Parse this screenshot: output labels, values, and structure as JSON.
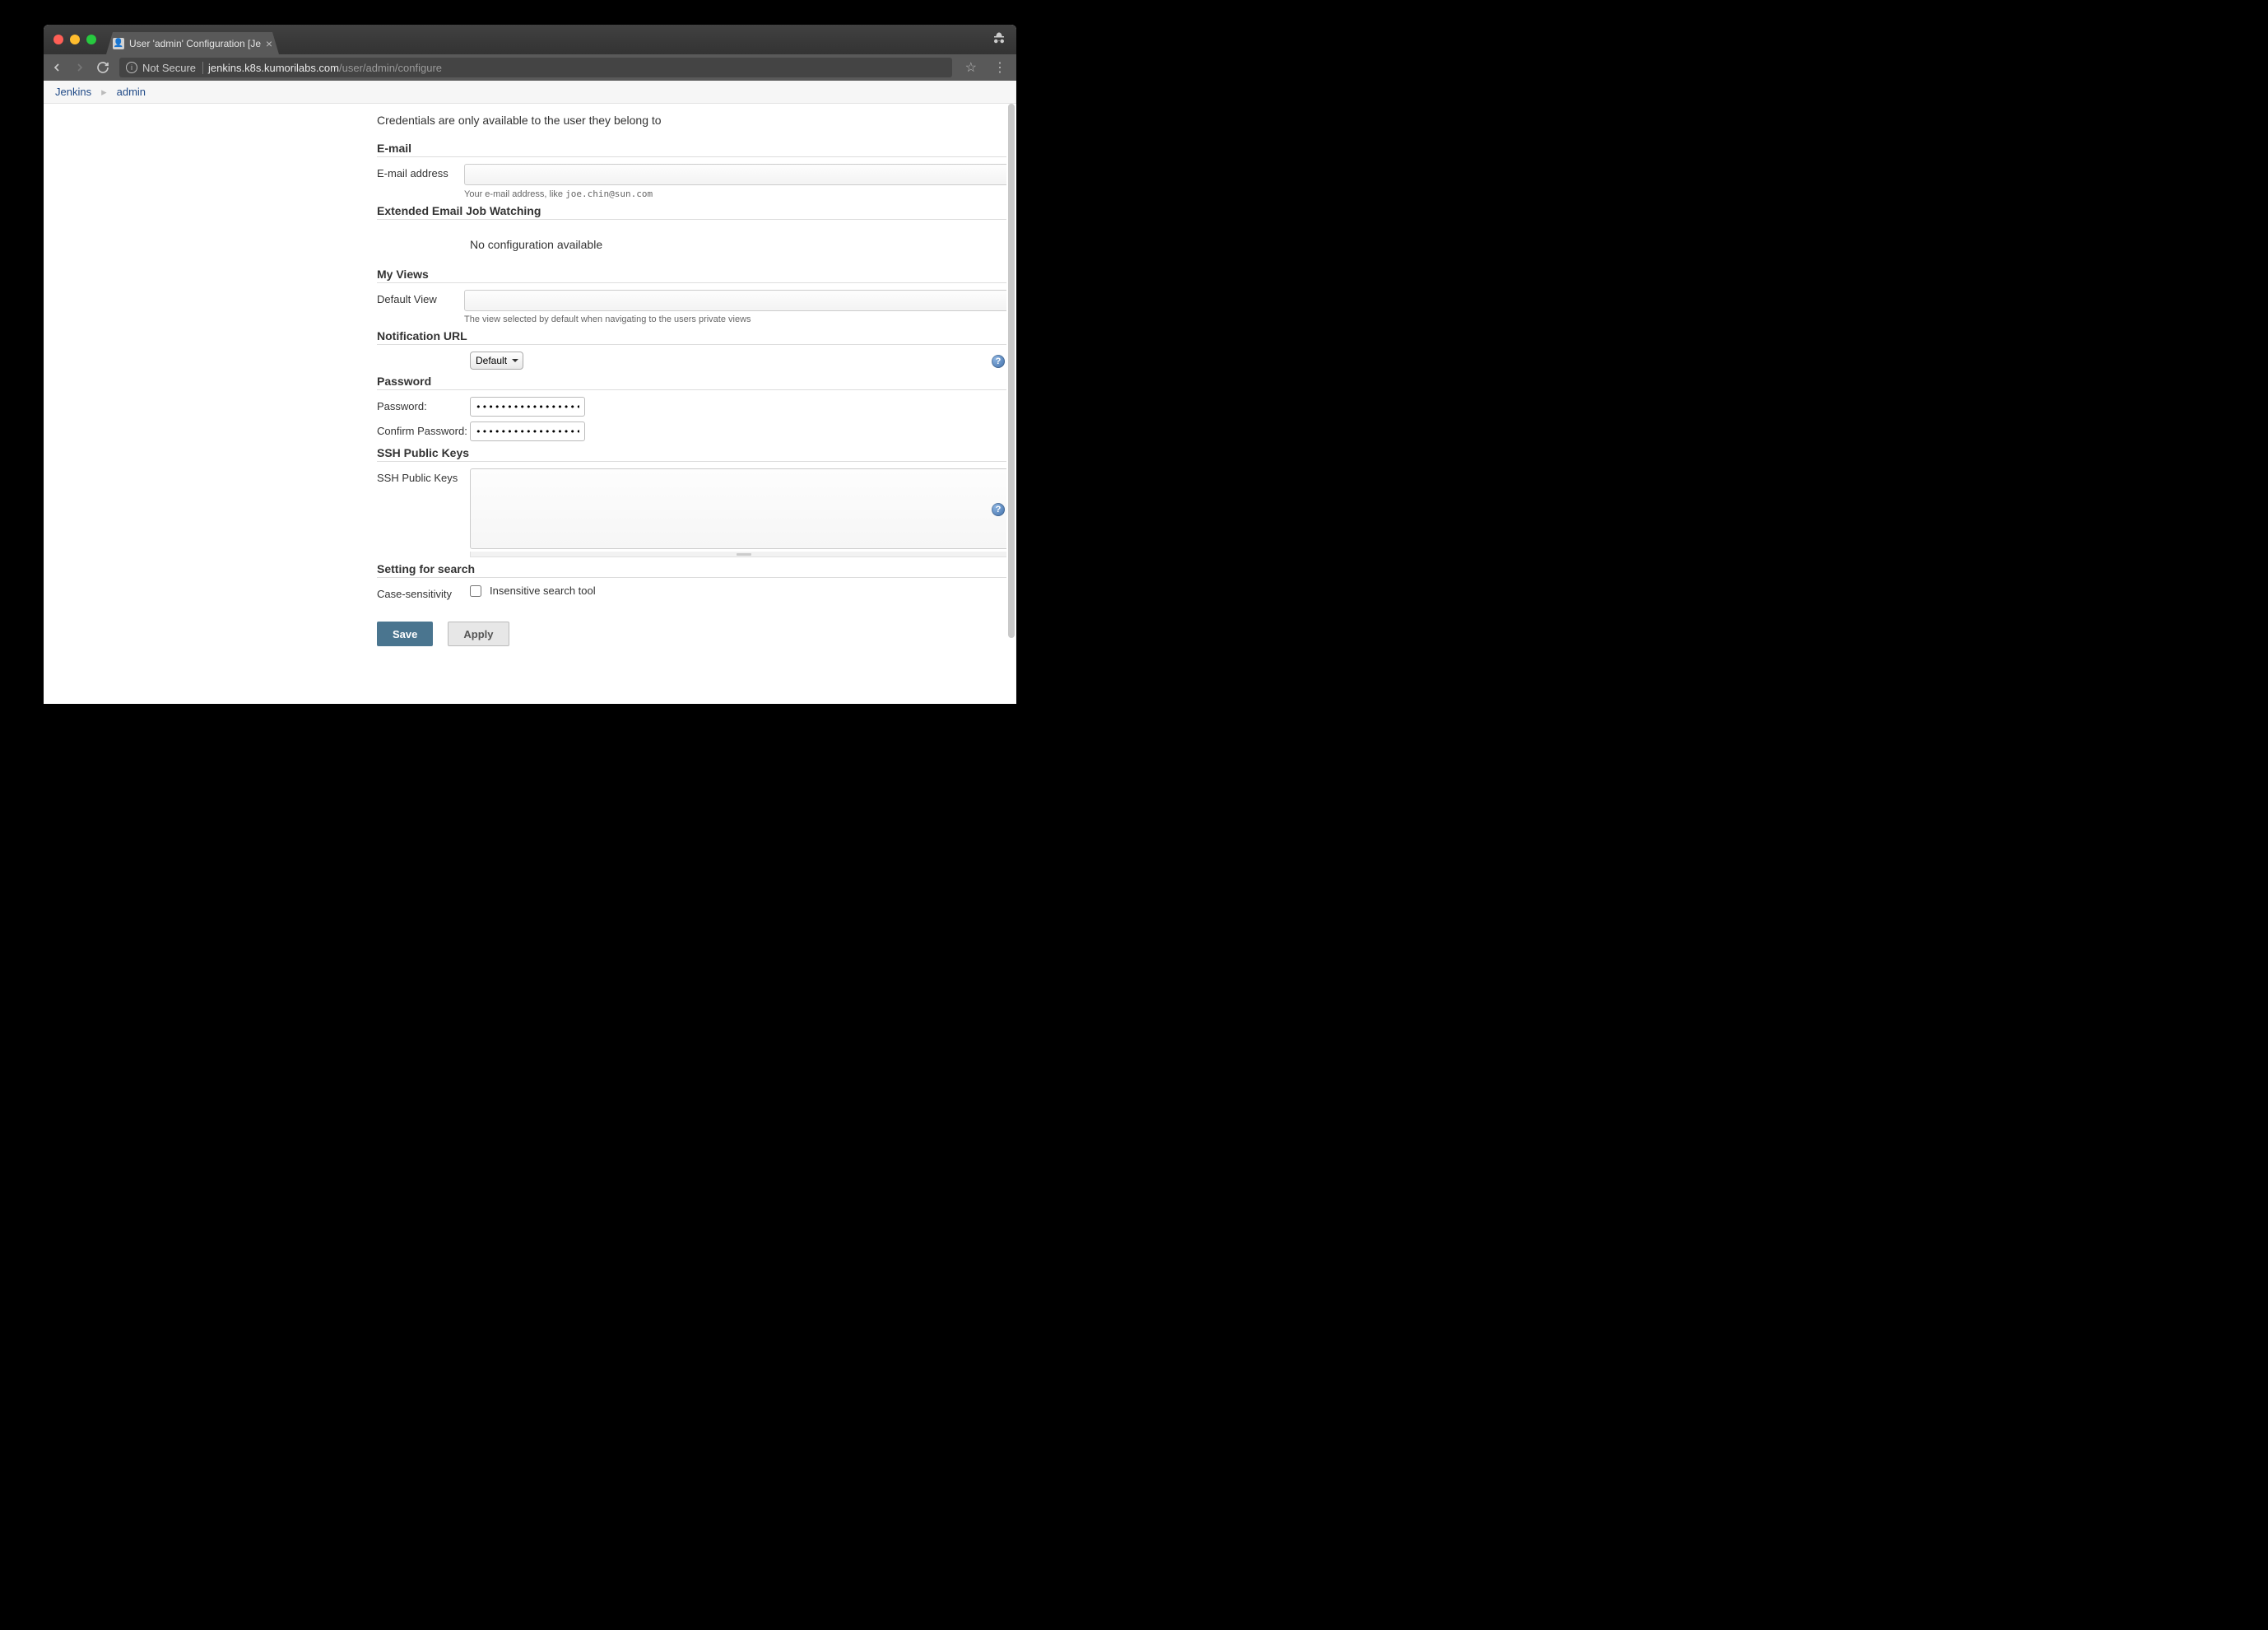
{
  "browser": {
    "tab_title": "User 'admin' Configuration [Je",
    "not_secure": "Not Secure",
    "url_host": "jenkins.k8s.kumorilabs.com",
    "url_path": "/user/admin/configure"
  },
  "breadcrumb": {
    "items": [
      "Jenkins",
      "admin"
    ]
  },
  "credentials_note": "Credentials are only available to the user they belong to",
  "sections": {
    "email": {
      "title": "E-mail",
      "label": "E-mail address",
      "value": "",
      "help_prefix": "Your e-mail address, like ",
      "help_sample": "joe.chin@sun.com"
    },
    "extended_email": {
      "title": "Extended Email Job Watching",
      "message": "No configuration available"
    },
    "my_views": {
      "title": "My Views",
      "label": "Default View",
      "value": "",
      "help": "The view selected by default when navigating to the users private views"
    },
    "notification_url": {
      "title": "Notification URL",
      "selected": "Default"
    },
    "password": {
      "title": "Password",
      "pw_label": "Password:",
      "pw_value": "••••••••••••••••••••••••••••",
      "confirm_label": "Confirm Password:",
      "confirm_value": "••••••••••••••••••••••••••••"
    },
    "ssh": {
      "title": "SSH Public Keys",
      "label": "SSH Public Keys",
      "value": ""
    },
    "search": {
      "title": "Setting for search",
      "label": "Case-sensitivity",
      "checkbox_label": "Insensitive search tool",
      "checked": false
    }
  },
  "buttons": {
    "save": "Save",
    "apply": "Apply"
  }
}
